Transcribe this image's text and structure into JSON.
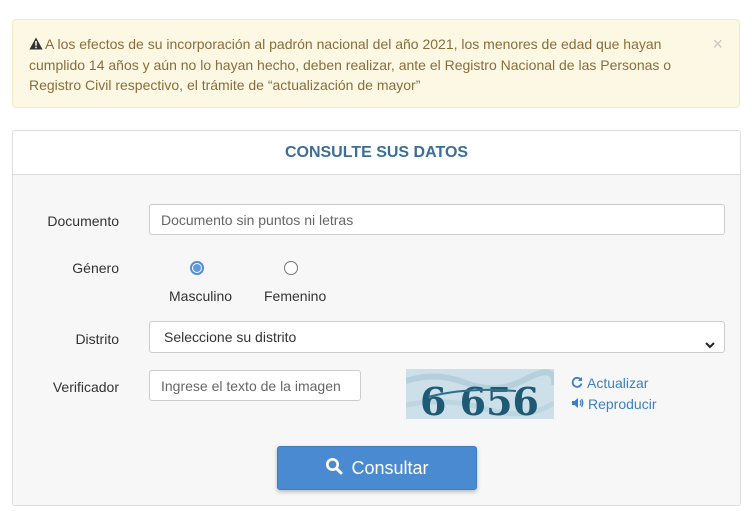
{
  "alert": {
    "message": "A los efectos de su incorporación al padrón nacional del año 2021, los menores de edad que hayan cumplido 14 años y aún no lo hayan hecho, deben realizar, ante el Registro Nacional de las Personas o Registro Civil respectivo, el trámite de “actualización de mayor”",
    "close_label": "×",
    "icon": "warning-icon"
  },
  "panel": {
    "title": "CONSULTE SUS DATOS"
  },
  "form": {
    "documento": {
      "label": "Documento",
      "placeholder": "Documento sin puntos ni letras",
      "value": ""
    },
    "genero": {
      "label": "Género",
      "options": [
        {
          "label": "Masculino",
          "checked": true
        },
        {
          "label": "Femenino",
          "checked": false
        }
      ]
    },
    "distrito": {
      "label": "Distrito",
      "selected": "Seleccione su distrito"
    },
    "verificador": {
      "label": "Verificador",
      "placeholder": "Ingrese el texto de la imagen",
      "captcha_text": "6 656",
      "refresh_label": "Actualizar",
      "audio_label": "Reproducir"
    },
    "submit_label": "Consultar"
  },
  "colors": {
    "accent": "#4a8ad1",
    "title": "#3c6e96",
    "alert_bg": "#fcf8e3",
    "alert_text": "#8a6d3b",
    "link": "#3b7fc4"
  }
}
